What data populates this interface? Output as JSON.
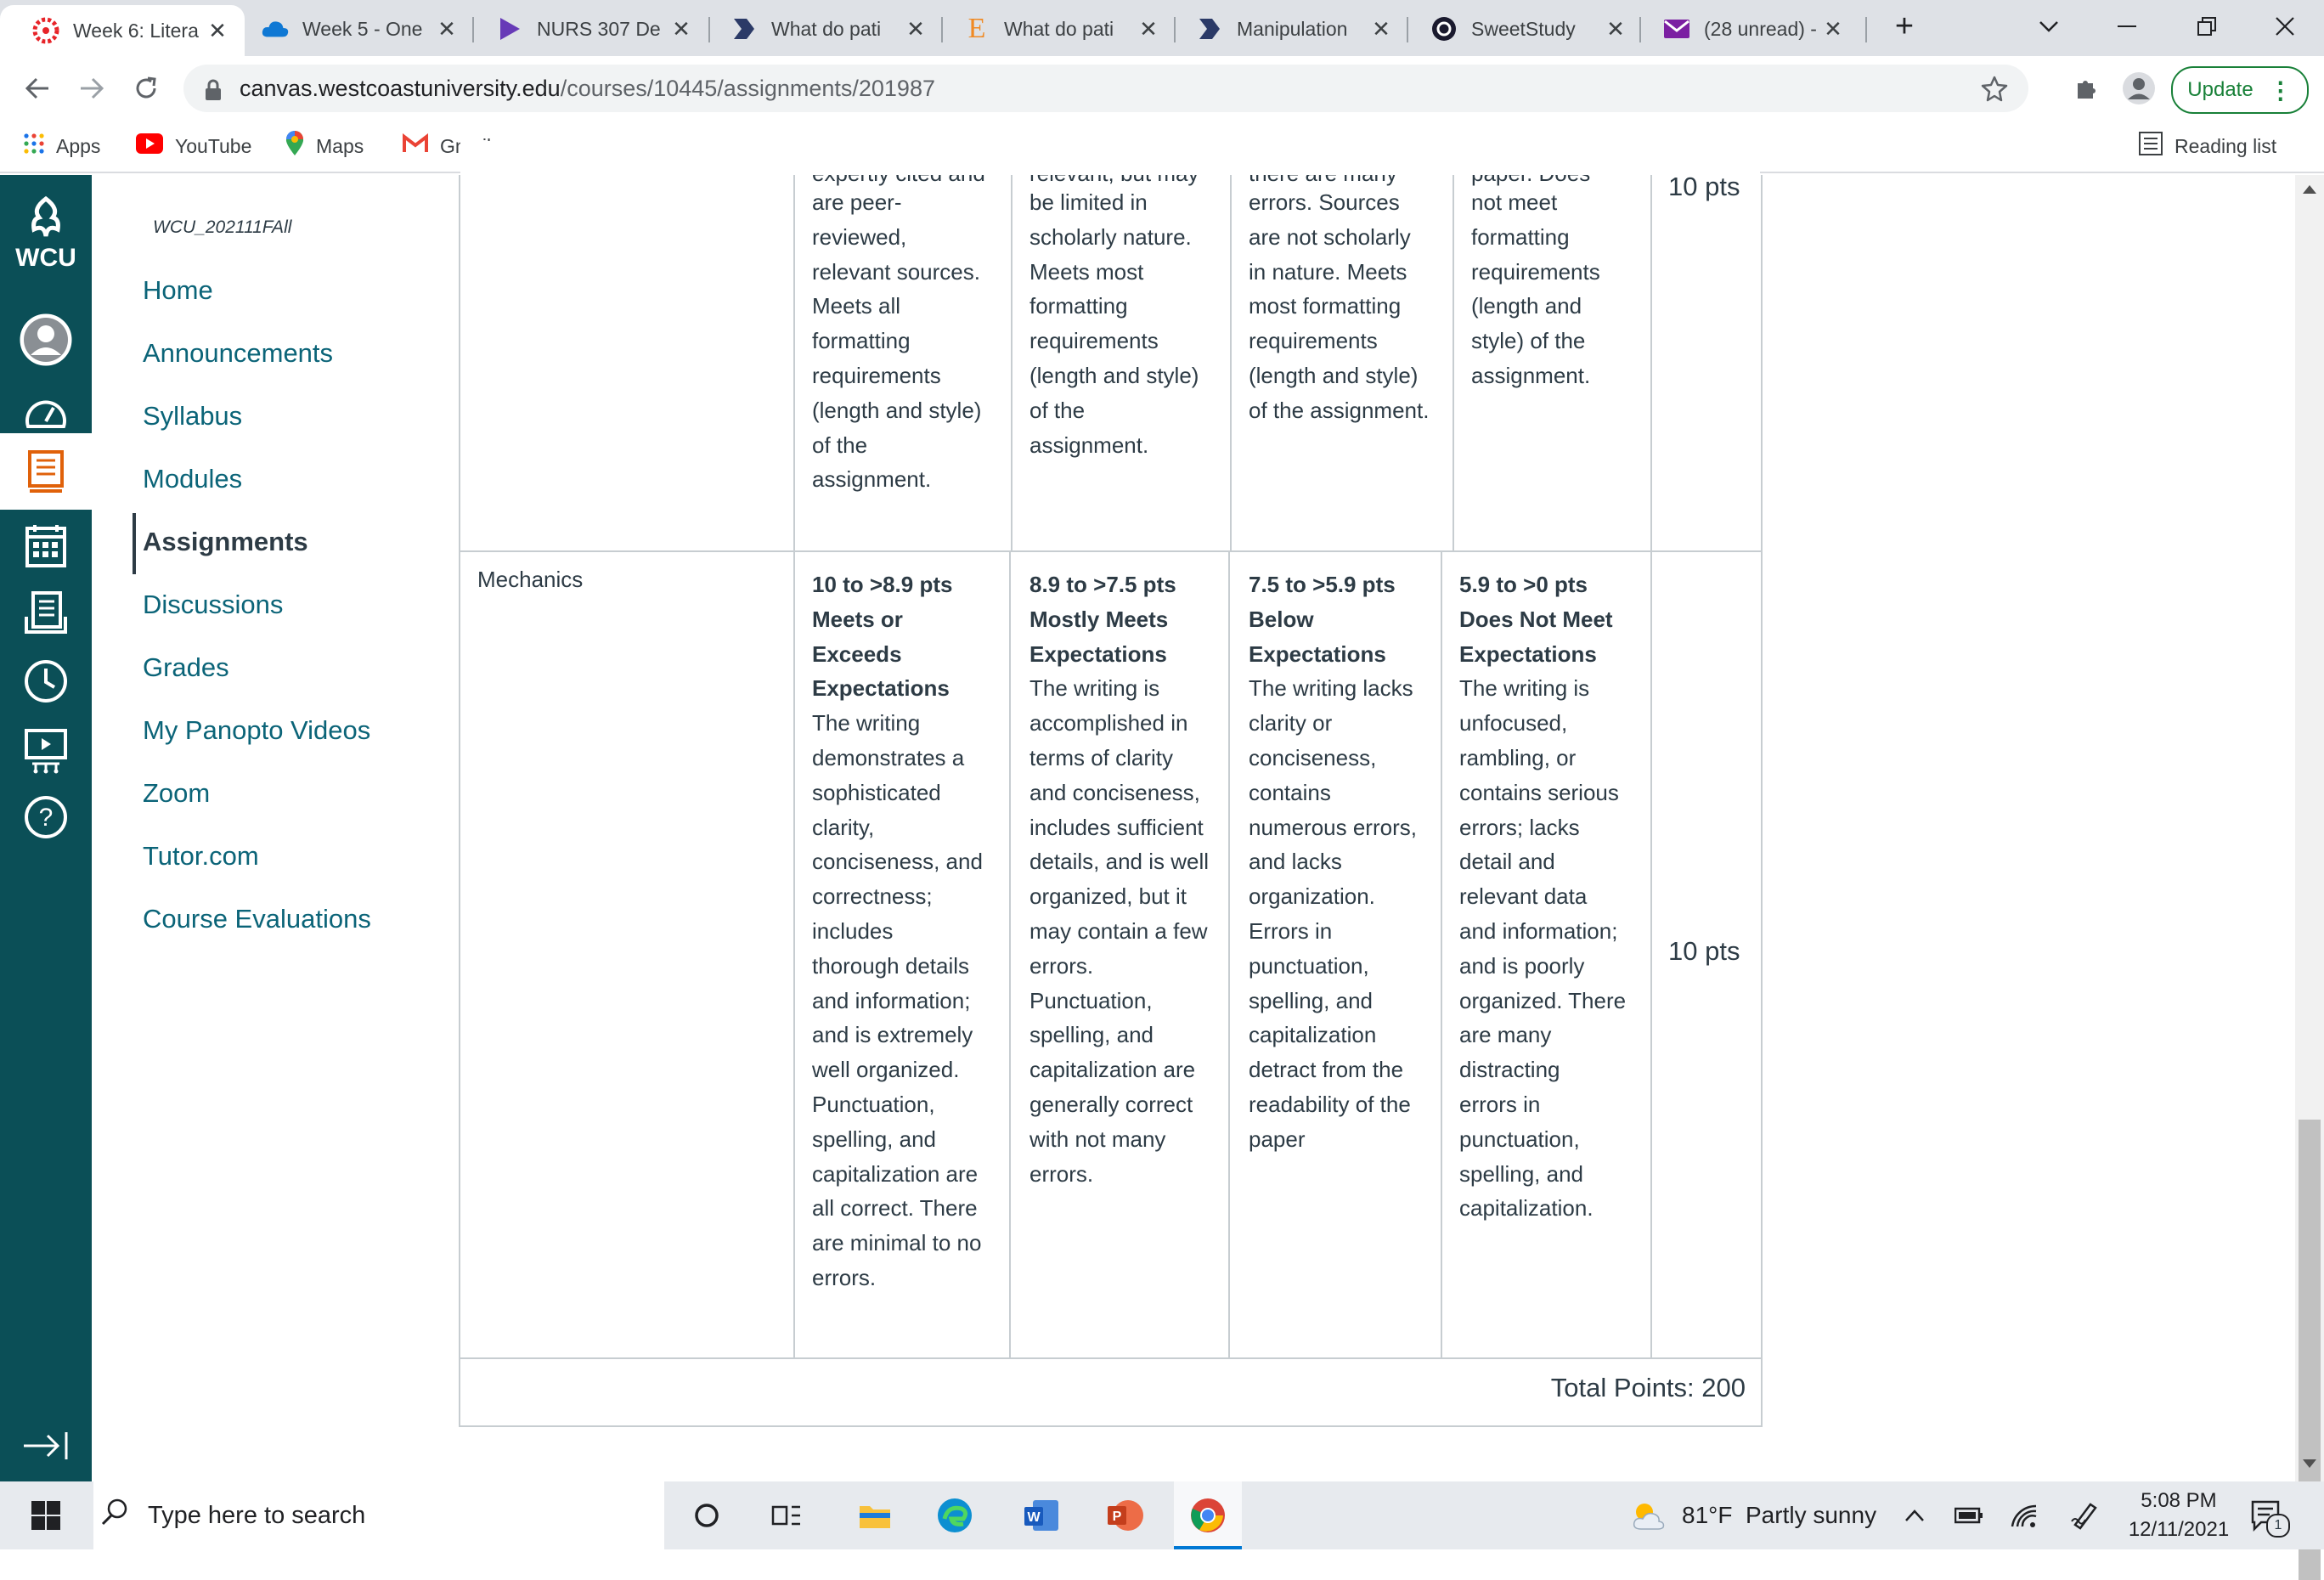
{
  "browser": {
    "tabs": [
      {
        "title": "Week 6: Litera",
        "icon": "canvas-icon",
        "color": "#e72429",
        "active": true
      },
      {
        "title": "Week 5 - One",
        "icon": "onedrive-icon",
        "color": "#0f78d4"
      },
      {
        "title": "NURS 307 De",
        "icon": "play-icon",
        "color": "#673ab7"
      },
      {
        "title": "What do pati",
        "icon": "bookmark-flag-icon",
        "color": "#2b3a67"
      },
      {
        "title": "What do pati",
        "icon": "e-letter-icon",
        "color": "#f08a24"
      },
      {
        "title": "Manipulation",
        "icon": "bookmark-flag-icon",
        "color": "#2b3a67"
      },
      {
        "title": "SweetStudy",
        "icon": "sweetstudy-icon",
        "color": "#1a1a2e"
      },
      {
        "title": "(28 unread) -",
        "icon": "mail-icon",
        "color": "#7b1fa2"
      }
    ],
    "new_tab": "+",
    "address": {
      "host": "canvas.westcoastuniversity.edu",
      "path": "/courses/10445/assignments/201987"
    },
    "update_label": "Update",
    "bookmarks": [
      {
        "label": "Apps",
        "icon": "apps-grid-icon"
      },
      {
        "label": "YouTube",
        "icon": "youtube-icon"
      },
      {
        "label": "Maps",
        "icon": "maps-pin-icon"
      },
      {
        "label": "Gmail",
        "icon": "gmail-icon"
      }
    ],
    "reading_list": "Reading list"
  },
  "global_nav": {
    "logo": "WCU",
    "icons": [
      "account-icon",
      "dashboard-icon",
      "courses-icon",
      "calendar-icon",
      "inbox-icon",
      "history-icon",
      "studio-icon",
      "help-icon"
    ],
    "collapse_icon": "collapse-nav-icon"
  },
  "course_nav": {
    "course_code": "WCU_202111FAll",
    "items": [
      "Home",
      "Announcements",
      "Syllabus",
      "Modules",
      "Assignments",
      "Discussions",
      "Grades",
      "My Panopto Videos",
      "Zoom",
      "Tutor.com",
      "Course Evaluations"
    ],
    "active": "Assignments"
  },
  "rubric": {
    "prev_row": {
      "top_fragments": [
        "expertly cited and",
        "relevant, but may",
        "there are many",
        "paper. Does"
      ],
      "cells": [
        [
          "are peer-",
          "reviewed,",
          "relevant sources.",
          "Meets all",
          "formatting",
          "requirements",
          "(length and style)",
          "of the",
          "assignment."
        ],
        [
          "be limited in",
          "scholarly nature.",
          "Meets most",
          "formatting",
          "requirements",
          "(length and style)",
          "of the",
          "assignment."
        ],
        [
          "errors. Sources",
          "are not scholarly",
          "in nature. Meets",
          "most formatting",
          "requirements",
          "(length and style)",
          "of the assignment."
        ],
        [
          "not meet",
          "formatting",
          "requirements",
          "(length and",
          "style) of the",
          "assignment."
        ]
      ],
      "points": "10 pts"
    },
    "mechanics": {
      "criterion": "Mechanics",
      "ratings": [
        {
          "range": "10 to >8.9 pts",
          "title_lines": [
            "Meets or",
            "Exceeds",
            "Expectations"
          ],
          "desc_lines": [
            "The writing",
            "demonstrates a",
            "sophisticated",
            "clarity,",
            "conciseness, and",
            "correctness;",
            "includes",
            "thorough details",
            "and information;",
            "and is extremely",
            "well organized.",
            "Punctuation,",
            "spelling, and",
            "capitalization are",
            "all correct. There",
            "are minimal to no",
            "errors."
          ]
        },
        {
          "range": "8.9 to >7.5 pts",
          "title_lines": [
            "Mostly Meets",
            "Expectations"
          ],
          "desc_lines": [
            "The writing is",
            "accomplished in",
            "terms of clarity",
            "and conciseness,",
            "includes sufficient",
            "details, and is well",
            "organized, but it",
            "may contain a few",
            "errors.",
            "Punctuation,",
            "spelling, and",
            "capitalization are",
            "generally correct",
            "with not many",
            "errors."
          ]
        },
        {
          "range": "7.5 to >5.9 pts",
          "title_lines": [
            "Below",
            "Expectations"
          ],
          "desc_lines": [
            "The writing lacks",
            "clarity or",
            "conciseness,",
            "contains",
            "numerous errors,",
            "and lacks",
            "organization.",
            "Errors in",
            "punctuation,",
            "spelling, and",
            "capitalization",
            "detract from the",
            "readability of the",
            "paper"
          ]
        },
        {
          "range": "5.9 to >0 pts",
          "title_lines": [
            "Does Not Meet",
            "Expectations"
          ],
          "desc_lines": [
            "The writing is",
            "unfocused,",
            "rambling, or",
            "contains serious",
            "errors; lacks",
            "detail and",
            "relevant data",
            "and information;",
            "and is poorly",
            "organized. There",
            "are many",
            "distracting",
            "errors in",
            "punctuation,",
            "spelling, and",
            "capitalization."
          ]
        }
      ],
      "points": "10 pts"
    },
    "total": "Total Points: 200"
  },
  "taskbar": {
    "search_placeholder": "Type here to search",
    "apps": [
      "cortana-icon",
      "task-view-icon",
      "file-explorer-icon",
      "edge-icon",
      "word-icon",
      "powerpoint-icon",
      "chrome-icon"
    ],
    "weather": "81°F  Partly sunny",
    "time": "5:08 PM",
    "date": "12/11/2021",
    "notification_count": "1"
  }
}
